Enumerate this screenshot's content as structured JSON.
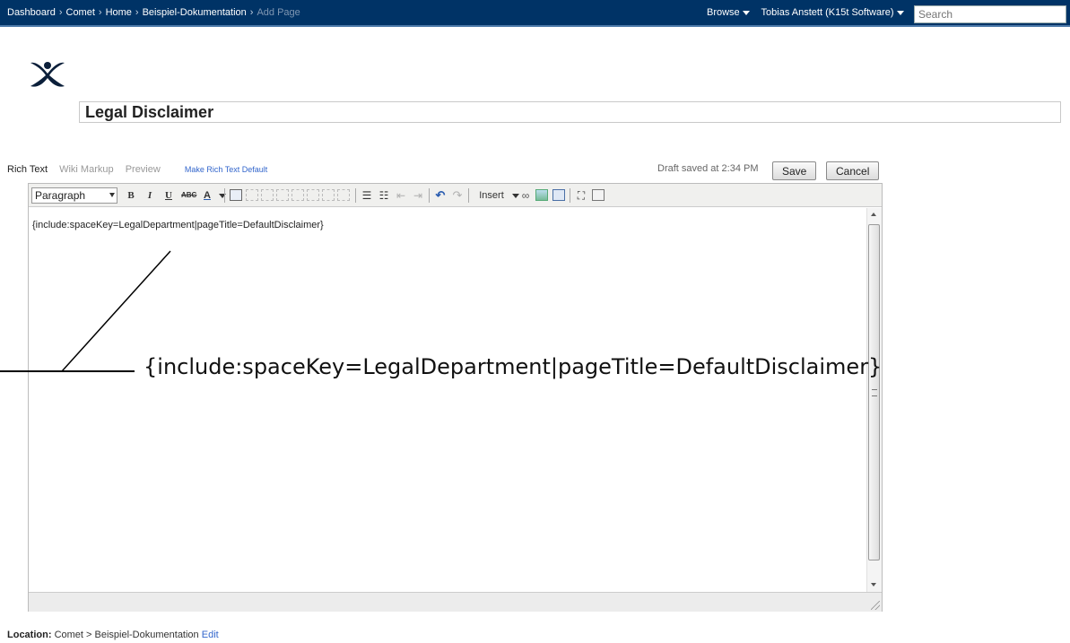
{
  "breadcrumb": {
    "items": [
      "Dashboard",
      "Comet",
      "Home",
      "Beispiel-Dokumentation"
    ],
    "current": "Add Page",
    "separator": "›"
  },
  "topnav": {
    "browse": "Browse",
    "user": "Tobias Anstett (K15t Software)",
    "search_placeholder": "Search"
  },
  "page": {
    "title_value": "Legal Disclaimer"
  },
  "editor": {
    "tabs": [
      "Rich Text",
      "Wiki Markup",
      "Preview"
    ],
    "make_default": "Make Rich Text Default",
    "draft_status": "Draft saved at 2:34 PM",
    "save_label": "Save",
    "cancel_label": "Cancel",
    "format_select": "Paragraph",
    "insert_label": "Insert",
    "content": "{include:spaceKey=LegalDepartment|pageTitle=DefaultDisclaimer}"
  },
  "footer": {
    "location_label": "Location:",
    "location_path": "Comet > Beispiel-Dokumentation",
    "edit_label": "Edit"
  },
  "callout": {
    "text": "{include:spaceKey=LegalDepartment|pageTitle=DefaultDisclaimer}"
  },
  "colors": {
    "topbar": "#003366",
    "link": "#3366cc"
  }
}
